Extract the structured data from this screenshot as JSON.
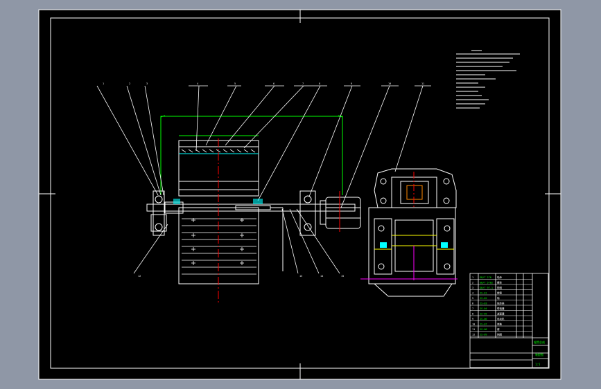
{
  "colors": {
    "background": "#8f97a6",
    "paper": "#000000",
    "line": "#ffffff",
    "dimension": "#00ff00",
    "center_line": "#ff0000",
    "accent": "#ff00ff",
    "highlight": "#ffff00",
    "hatch": "#00ffff"
  },
  "part_labels": [
    "1",
    "2",
    "3",
    "4",
    "5",
    "6",
    "7",
    "8",
    "9",
    "10",
    "11",
    "12",
    "13",
    "14",
    "15",
    "16",
    "17",
    "18"
  ],
  "title_block": {
    "drawing_name": "辊筒总成",
    "scale": "1:5",
    "sheet": "装配图"
  },
  "bom_rows": [
    {
      "no": "1",
      "code": "GB/T 276",
      "name": "轴承"
    },
    {
      "no": "2",
      "code": "GB/T 5782",
      "name": "螺栓"
    },
    {
      "no": "3",
      "code": "GB/T 97.1",
      "name": "垫圈"
    },
    {
      "no": "4",
      "code": "JS-01",
      "name": "辊筒"
    },
    {
      "no": "5",
      "code": "JS-02",
      "name": "轴"
    },
    {
      "no": "6",
      "code": "JS-03",
      "name": "轴承座"
    },
    {
      "no": "7",
      "code": "JS-04",
      "name": "联轴器"
    },
    {
      "no": "8",
      "code": "JS-05",
      "name": "减速器"
    },
    {
      "no": "9",
      "code": "JS-06",
      "name": "电动机"
    },
    {
      "no": "10",
      "code": "JS-07",
      "name": "端盖"
    },
    {
      "no": "11",
      "code": "JS-08",
      "name": "键"
    },
    {
      "no": "12",
      "code": "JS-09",
      "name": "挡圈"
    }
  ]
}
